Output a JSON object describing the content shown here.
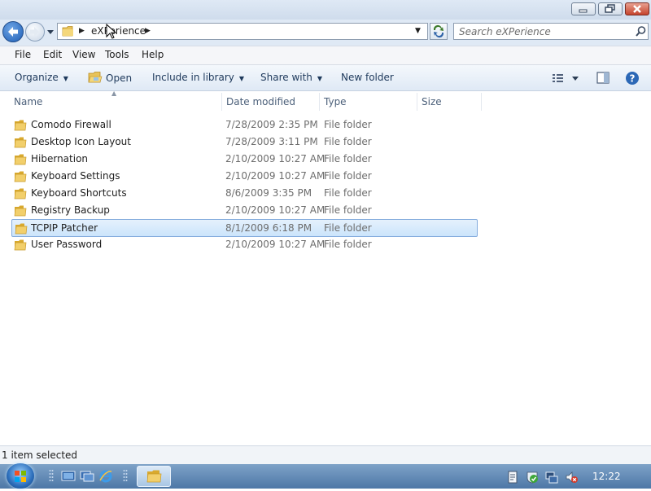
{
  "window": {
    "address": {
      "breadcrumb": "eXPerience"
    },
    "search": {
      "placeholder": "Search eXPerience"
    }
  },
  "menu": [
    "File",
    "Edit",
    "View",
    "Tools",
    "Help"
  ],
  "toolbar": {
    "organize": "Organize",
    "open": "Open",
    "include_in_library": "Include in library",
    "share_with": "Share with",
    "new_folder": "New folder"
  },
  "columns": {
    "name": "Name",
    "date_modified": "Date modified",
    "type": "Type",
    "size": "Size"
  },
  "files": [
    {
      "name": "Comodo Firewall",
      "date": "7/28/2009 2:35 PM",
      "type": "File folder",
      "selected": false
    },
    {
      "name": "Desktop Icon Layout",
      "date": "7/28/2009 3:11 PM",
      "type": "File folder",
      "selected": false
    },
    {
      "name": "Hibernation",
      "date": "2/10/2009 10:27 AM",
      "type": "File folder",
      "selected": false
    },
    {
      "name": "Keyboard Settings",
      "date": "2/10/2009 10:27 AM",
      "type": "File folder",
      "selected": false
    },
    {
      "name": "Keyboard Shortcuts",
      "date": "8/6/2009 3:35 PM",
      "type": "File folder",
      "selected": false
    },
    {
      "name": "Registry Backup",
      "date": "2/10/2009 10:27 AM",
      "type": "File folder",
      "selected": false
    },
    {
      "name": "TCPIP Patcher",
      "date": "8/1/2009 6:18 PM",
      "type": "File folder",
      "selected": true
    },
    {
      "name": "User Password",
      "date": "2/10/2009 10:27 AM",
      "type": "File folder",
      "selected": false
    }
  ],
  "status": {
    "text": "1 item selected"
  },
  "taskbar": {
    "clock": "12:22"
  },
  "icons": {
    "back": "back-arrow-icon",
    "forward": "forward-arrow-icon",
    "folder": "folder-icon",
    "search": "search-icon",
    "refresh": "refresh-icon",
    "help": "help-icon",
    "views": "views-icon",
    "preview_pane": "preview-pane-icon"
  },
  "colors": {
    "selection_fill": "#cbe4fb",
    "selection_border": "#84acdd",
    "folder": "#e8c35a",
    "taskbar": "#5a82b0"
  }
}
